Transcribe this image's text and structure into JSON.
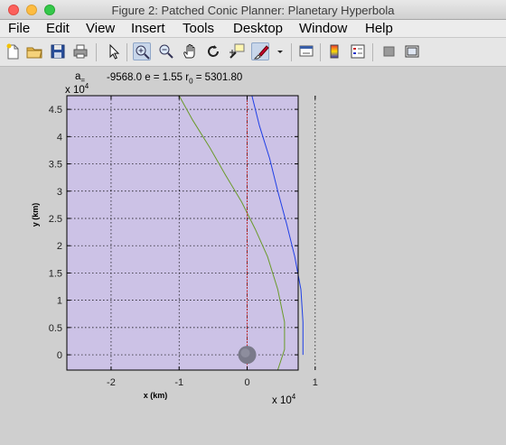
{
  "window": {
    "title": "Figure 2: Patched Conic Planner: Planetary Hyperbola"
  },
  "menu": [
    "File",
    "Edit",
    "View",
    "Insert",
    "Tools",
    "Desktop",
    "Window",
    "Help"
  ],
  "toolbar": {
    "icons": [
      "new-file-icon",
      "open-folder-icon",
      "save-icon",
      "print-icon",
      "pointer-icon",
      "zoom-in-icon",
      "zoom-out-icon",
      "pan-hand-icon",
      "rotate-3d-icon",
      "data-cursor-icon",
      "brush-icon",
      "link-plot-icon",
      "colorbar-icon",
      "legend-icon",
      "hide-plot-tools-icon",
      "show-plot-tools-icon"
    ],
    "active": "zoom-in-icon"
  },
  "annotation": {
    "a_label": "a",
    "a_sub": "=",
    "text_mid": "-9568.0 e = 1.55 r",
    "r_sub": "0",
    "text_end": " = 5301.80",
    "y_scale": "x 10",
    "y_scale_exp": "4",
    "x_scale": "x 10",
    "x_scale_exp": "4"
  },
  "colors": {
    "plot_bg": "#ccc2e6",
    "trajectory_blue": "#1f3fe6",
    "trajectory_green": "#6a9a2a",
    "vertical_red": "#cc1a1a",
    "planet": "#7a7a8a"
  },
  "chart_data": {
    "type": "line",
    "xlabel": "x (km)",
    "ylabel": "y (km)",
    "xlim": [
      -2.65,
      0.75
    ],
    "ylim": [
      -0.28,
      4.75
    ],
    "x_scale_exponent": 4,
    "y_scale_exponent": 4,
    "xticks": [
      -2,
      -1,
      0,
      1
    ],
    "yticks": [
      0,
      0.5,
      1,
      1.5,
      2,
      2.5,
      3,
      3.5,
      4,
      4.5
    ],
    "grid": true,
    "series": [
      {
        "color": "blue",
        "x": [
          0.07,
          0.18,
          0.33,
          0.45,
          0.58,
          0.7,
          0.79,
          0.82,
          0.82
        ],
        "y": [
          4.75,
          4.2,
          3.6,
          3.0,
          2.4,
          1.8,
          1.2,
          0.6,
          0.0
        ]
      },
      {
        "color": "green",
        "x": [
          -1.0,
          -0.8,
          -0.55,
          -0.32,
          -0.08,
          0.12,
          0.3,
          0.45,
          0.55,
          0.55,
          0.45
        ],
        "y": [
          4.75,
          4.3,
          3.8,
          3.3,
          2.8,
          2.3,
          1.8,
          1.2,
          0.6,
          0.1,
          -0.28
        ]
      },
      {
        "color": "red",
        "style": "dotted",
        "x": [
          0.0,
          0.0
        ],
        "y": [
          -0.28,
          4.75
        ]
      }
    ],
    "planet": {
      "x": 0.0,
      "y": 0.0
    }
  }
}
